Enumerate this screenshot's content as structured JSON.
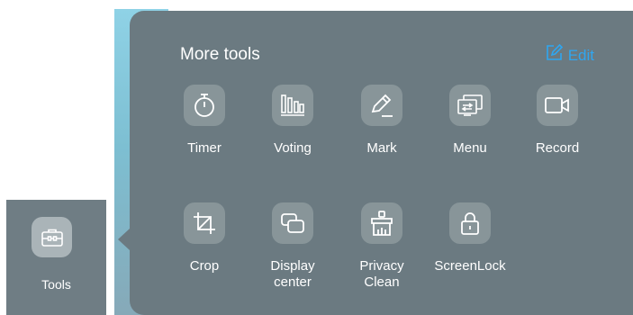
{
  "sidebar": {
    "tools_label": "Tools",
    "tools_icon": "toolbox-icon"
  },
  "panel": {
    "title": "More tools",
    "edit_label": "Edit",
    "edit_icon": "edit-icon",
    "tools": [
      {
        "label": "Timer",
        "icon": "stopwatch-icon"
      },
      {
        "label": "Voting",
        "icon": "bar-chart-icon"
      },
      {
        "label": "Mark",
        "icon": "pen-icon"
      },
      {
        "label": "Menu",
        "icon": "screen-switch-icon"
      },
      {
        "label": "Record",
        "icon": "video-camera-icon"
      },
      {
        "label": "Crop",
        "icon": "crop-icon"
      },
      {
        "label": "Display\ncenter",
        "icon": "display-windows-icon"
      },
      {
        "label": "Privacy\nClean",
        "icon": "brush-icon"
      },
      {
        "label": "ScreenLock",
        "icon": "lock-icon"
      }
    ]
  },
  "colors": {
    "panel_bg": "#6b7a81",
    "tile_bg": "#889599",
    "accent": "#2fa6f0",
    "text": "#ffffff"
  }
}
